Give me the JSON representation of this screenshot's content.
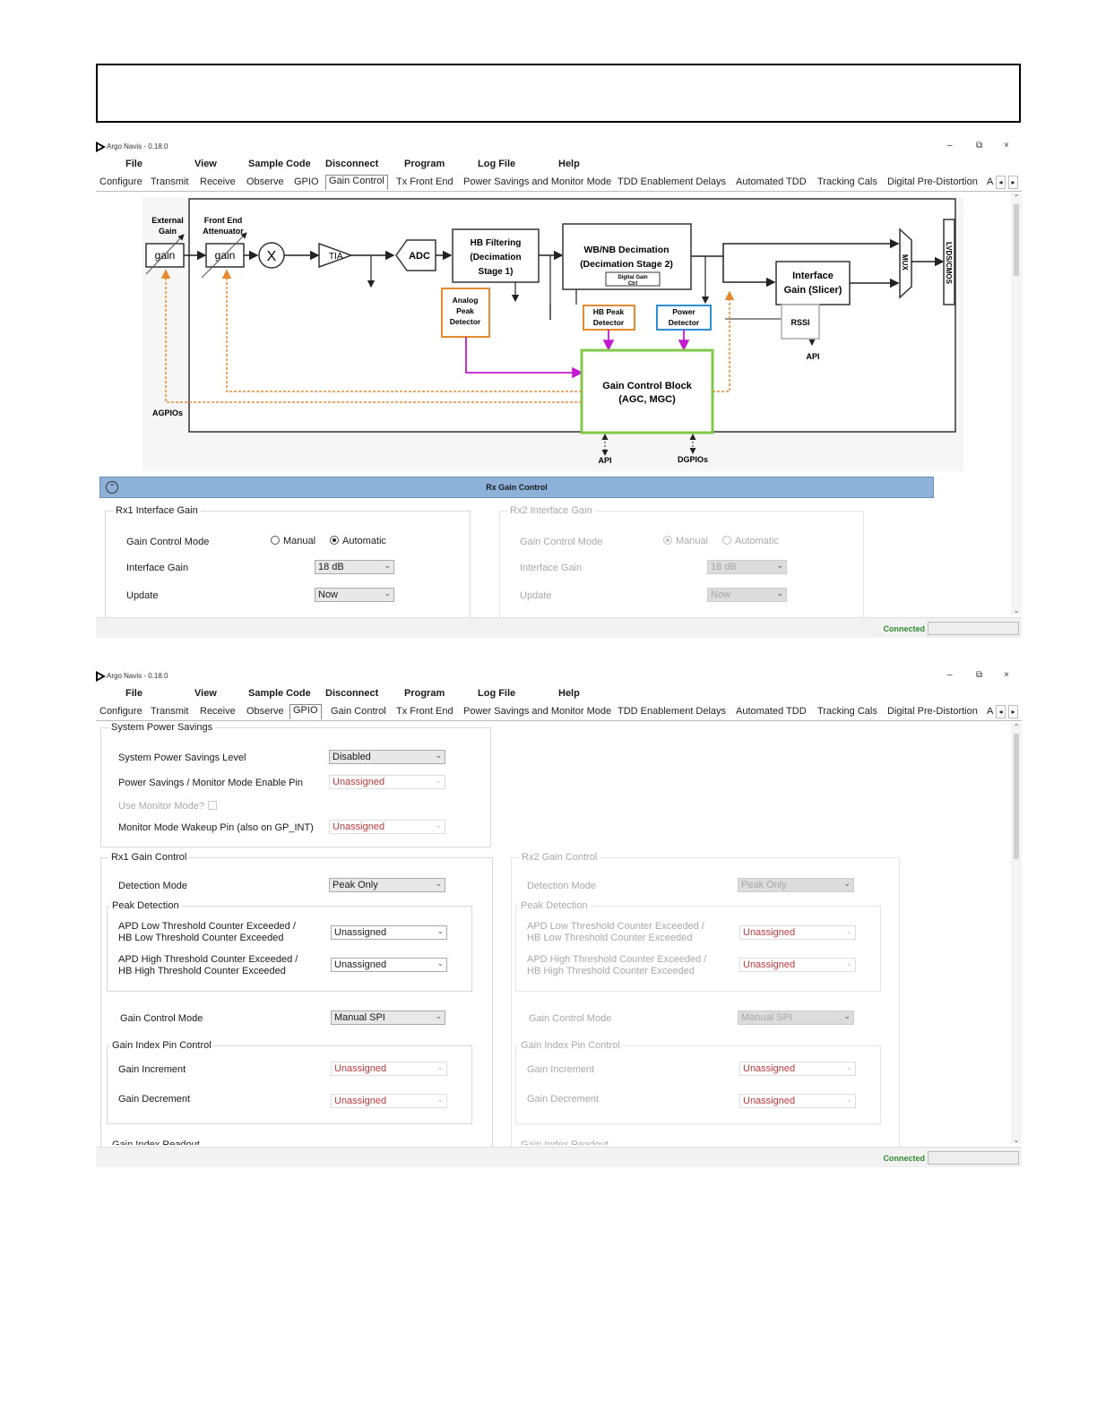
{
  "app": {
    "title": "Argo Navis - 0.18.0",
    "controls": [
      "–",
      "⧉",
      "×"
    ],
    "menu": [
      "File",
      "View",
      "Sample Code",
      "Disconnect",
      "Program",
      "Log File",
      "Help"
    ],
    "tabs": [
      "Configure",
      "Transmit",
      "Receive",
      "Observe",
      "GPIO",
      "Gain Control",
      "Tx Front End",
      "Power Savings and Monitor Mode",
      "TDD Enablement Delays",
      "Automated TDD",
      "Tracking Cals",
      "Digital Pre-Distortion",
      "A"
    ],
    "status": "Connected"
  },
  "window1": {
    "active_tab": "Gain Control",
    "diagram": {
      "external_gain": "External\nGain",
      "front_end_attenuator": "Front End\nAttenuator",
      "gain": "gain",
      "mixer": "X",
      "tia": "TIA",
      "adc": "ADC",
      "hb_filtering": "HB Filtering\n(Decimation\nStage 1)",
      "wbnb_decimation": "WB/NB Decimation\n(Decimation Stage 2)",
      "digital_gain_ctrl": "Digital Gain\nCtrl",
      "mux": "MUX",
      "lvds_cmos": "LVDS/CMOS",
      "interface_gain_slicer": "Interface\nGain (Slicer)",
      "analog_peak_detector": "Analog\nPeak\nDetector",
      "hb_peak_detector": "HB Peak\nDetector",
      "power_detector": "Power\nDetector",
      "rssi": "RSSI",
      "gain_control_block": "Gain Control Block\n(AGC, MGC)",
      "agpios": "AGPIOs",
      "api": "API",
      "dgpios": "DGPIOs",
      "colors": {
        "orange": "#e58a2e",
        "blue": "#2e8fd6",
        "green": "#82c84a",
        "magenta": "#c21bd0",
        "arrow": "#222222"
      }
    },
    "rx_gain_control": {
      "header": "Rx Gain Control",
      "rx1": {
        "title": "Rx1 Interface Gain",
        "gain_control_mode_label": "Gain Control Mode",
        "manual": "Manual",
        "automatic": "Automatic",
        "selected": "Automatic",
        "interface_gain_label": "Interface Gain",
        "interface_gain_value": "18 dB",
        "update_label": "Update",
        "update_value": "Now"
      },
      "rx2": {
        "title": "Rx2 Interface Gain",
        "gain_control_mode_label": "Gain Control Mode",
        "manual": "Manual",
        "automatic": "Automatic",
        "selected": "Manual",
        "interface_gain_label": "Interface Gain",
        "interface_gain_value": "18 dB",
        "update_label": "Update",
        "update_value": "Now"
      }
    }
  },
  "window2": {
    "active_tab": "GPIO",
    "system_power_savings": {
      "title": "System Power Savings",
      "level_label": "System Power Savings Level",
      "level_value": "Disabled",
      "enable_pin_label": "Power Savings / Monitor Mode Enable Pin",
      "enable_pin_value": "Unassigned",
      "use_monitor_label": "Use Monitor Mode?",
      "wakeup_pin_label": "Monitor Mode Wakeup Pin (also on GP_INT)",
      "wakeup_pin_value": "Unassigned"
    },
    "rx1": {
      "title": "Rx1 Gain Control",
      "detection_mode_label": "Detection Mode",
      "detection_mode_value": "Peak Only",
      "peak_detection_title": "Peak Detection",
      "apd_low_label": "APD Low Threshold Counter Exceeded /\nHB Low Threshold Counter Exceeded",
      "apd_low_value": "Unassigned",
      "apd_high_label": "APD High Threshold Counter Exceeded /\nHB High Threshold Counter Exceeded",
      "apd_high_value": "Unassigned",
      "gain_control_mode_label": "Gain Control Mode",
      "gain_control_mode_value": "Manual SPI",
      "gain_index_pin_title": "Gain Index Pin Control",
      "gain_increment_label": "Gain Increment",
      "gain_increment_value": "Unassigned",
      "gain_decrement_label": "Gain Decrement",
      "gain_decrement_value": "Unassigned",
      "gain_index_readout_title": "Gain Index Readout"
    },
    "rx2": {
      "title": "Rx2 Gain Control",
      "detection_mode_label": "Detection Mode",
      "detection_mode_value": "Peak Only",
      "peak_detection_title": "Peak Detection",
      "apd_low_label": "APD Low Threshold Counter Exceeded /\nHB Low Threshold Counter Exceeded",
      "apd_low_value": "Unassigned",
      "apd_high_label": "APD High Threshold Counter Exceeded /\nHB High Threshold Counter Exceeded",
      "apd_high_value": "Unassigned",
      "gain_control_mode_label": "Gain Control Mode",
      "gain_control_mode_value": "Manual SPI",
      "gain_index_pin_title": "Gain Index Pin Control",
      "gain_increment_label": "Gain Increment",
      "gain_increment_value": "Unassigned",
      "gain_decrement_label": "Gain Decrement",
      "gain_decrement_value": "Unassigned",
      "gain_index_readout_title": "Gain Index Readout"
    }
  }
}
